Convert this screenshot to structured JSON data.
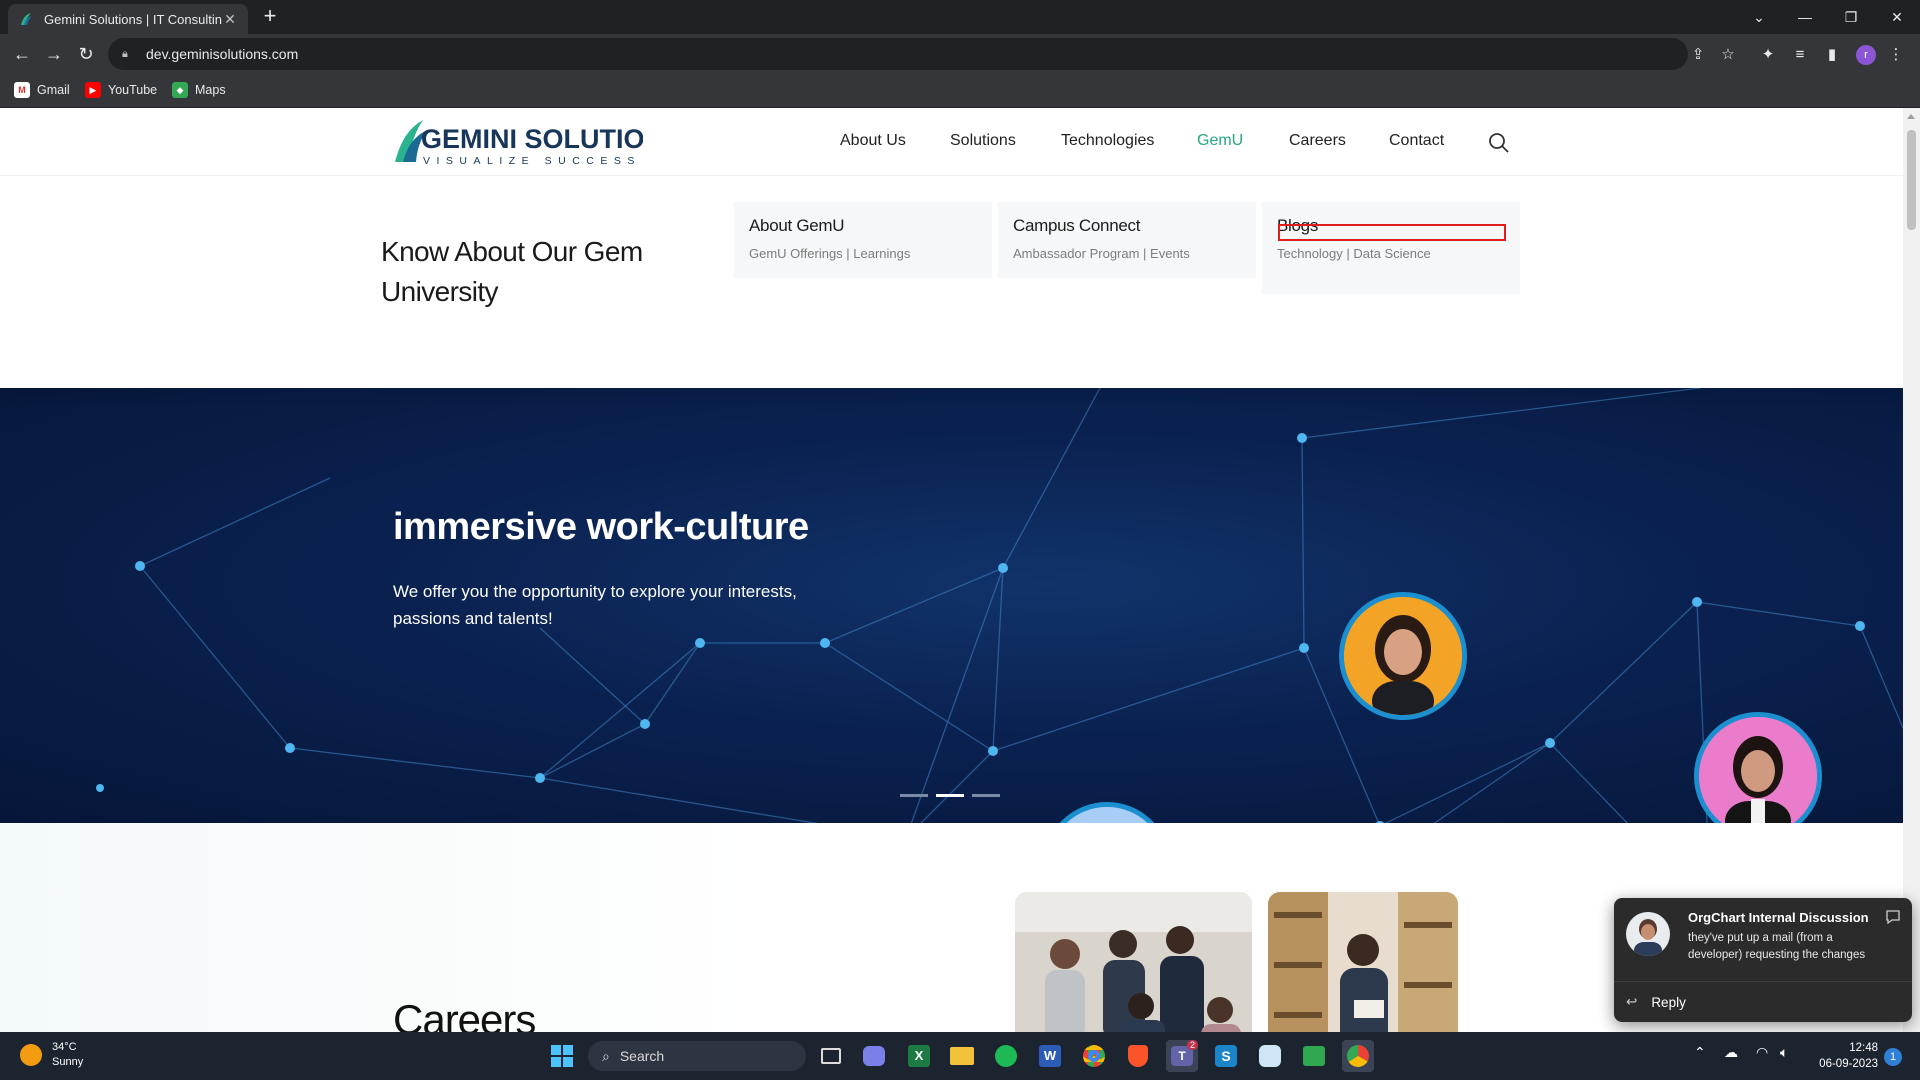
{
  "browser": {
    "tab": {
      "title": "Gemini Solutions | IT Consulting,",
      "close": "✕"
    },
    "new_tab": "+",
    "url": "dev.geminisolutions.com",
    "profile_initial": "r",
    "bookmarks": [
      {
        "label": "Gmail",
        "icon": "gmail-icon"
      },
      {
        "label": "YouTube",
        "icon": "youtube-icon"
      },
      {
        "label": "Maps",
        "icon": "maps-icon"
      }
    ]
  },
  "site": {
    "logo": {
      "name": "GEMINI SOLUTIONS",
      "tagline": "VISUALIZE SUCCESS"
    },
    "nav": [
      "About Us",
      "Solutions",
      "Technologies",
      "GemU",
      "Careers",
      "Contact"
    ],
    "active_nav": "GemU",
    "accent_color": "#26a882"
  },
  "megamenu": {
    "heading": "Know About Our Gem University",
    "cards": [
      {
        "title": "About GemU",
        "subtitle": "GemU Offerings | Learnings"
      },
      {
        "title": "Campus Connect",
        "subtitle": "Ambassador Program | Events"
      },
      {
        "title": "Blogs",
        "subtitle": "Technology | Data Science"
      }
    ]
  },
  "hero": {
    "title": "immersive work-culture",
    "subtitle": "We offer you the opportunity to explore your interests, passions and talents!",
    "slide_count": 3,
    "active_slide": 2
  },
  "careers": {
    "title": "Careers"
  },
  "toast": {
    "title": "OrgChart Internal Discussion",
    "message": "they've put up a mail (from a developer) requesting the changes",
    "action": "Reply"
  },
  "taskbar": {
    "weather": {
      "temp": "34°C",
      "condition": "Sunny"
    },
    "search_placeholder": "Search",
    "teams_badge": "2",
    "time": "12:48",
    "date": "06-09-2023",
    "notifications": "1"
  }
}
